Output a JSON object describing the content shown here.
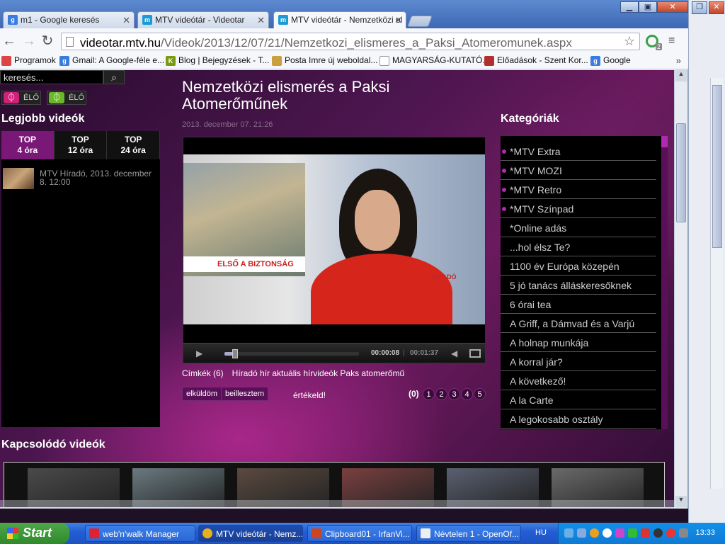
{
  "browser": {
    "tabs": [
      {
        "label": "m1 - Google keresés",
        "icon": "google-icon",
        "color": "#3a7be0"
      },
      {
        "label": "MTV videótár - Videotar",
        "icon": "mtv-icon",
        "color": "#1a9bd7"
      },
      {
        "label": "MTV videótár - Nemzetközi el",
        "icon": "mtv-icon",
        "color": "#1a9bd7"
      }
    ],
    "url_domain": "videotar.mtv.hu",
    "url_path": "/Videok/2013/12/07/21/Nemzetkozi_elismeres_a_Paksi_Atomeromunek.aspx",
    "ext_badge": "2",
    "bookmarks": [
      {
        "label": "Programok",
        "icon": "apps-icon",
        "color": "#d44"
      },
      {
        "label": "Gmail: A Google-féle e...",
        "icon": "google-icon",
        "color": "#3a7be0"
      },
      {
        "label": "Blog | Bejegyzések - T...",
        "icon": "k-icon",
        "color": "#7a9a10"
      },
      {
        "label": "Posta Imre új weboldal...",
        "icon": "posta-icon",
        "color": "#c9a040"
      },
      {
        "label": "MAGYARSÁG-KUTATÓ...",
        "icon": "page-icon",
        "color": "#bbb"
      },
      {
        "label": "Előadások - Szent Kor...",
        "icon": "crown-icon",
        "color": "#b03030"
      },
      {
        "label": "Google",
        "icon": "google-icon",
        "color": "#3a7be0"
      }
    ],
    "bookmarks_more": "»"
  },
  "sidebar": {
    "search_placeholder": "keresés...",
    "live": [
      {
        "label": "ÉLŐ",
        "color": "#d0207a"
      },
      {
        "label": "ÉLŐ",
        "color": "#6ab82a"
      }
    ],
    "best_title": "Legjobb videók",
    "top_tabs": [
      {
        "line1": "TOP",
        "line2": "4 óra"
      },
      {
        "line1": "TOP",
        "line2": "12 óra"
      },
      {
        "line1": "TOP",
        "line2": "24 óra"
      }
    ],
    "best_item": "MTV Híradó, 2013. december 8. 12:00"
  },
  "article": {
    "title": "Nemzetközi elismerés a Paksi Atomerőműnek",
    "date": "2013. december 07. 21:26",
    "video": {
      "inset_caption": "ELSŐ A BIZTONSÁG",
      "channel_tag": "HÍRADÓ",
      "time_current": "00:00:08",
      "time_sep": "|",
      "time_total": "00:01:37",
      "progress": 0.08
    },
    "tags_label": "Címkék (6)",
    "tags": "Híradó hír aktuális hírvideók Paks atomerőmű",
    "send_label": "elküldöm",
    "embed_label": "beillesztem",
    "rate_label": "értékeld!",
    "rate_count": "(0)",
    "stars": [
      "1",
      "2",
      "3",
      "4",
      "5"
    ]
  },
  "categories": {
    "title": "Kategóriák",
    "items": [
      {
        "label": "*MTV Extra",
        "dot": true
      },
      {
        "label": "*MTV MOZI",
        "dot": true
      },
      {
        "label": "*MTV Retro",
        "dot": true
      },
      {
        "label": "*MTV Színpad",
        "dot": true
      },
      {
        "label": "*Online adás",
        "dot": false
      },
      {
        "label": "...hol élsz Te?",
        "dot": false
      },
      {
        "label": "1100 év Európa közepén",
        "dot": false
      },
      {
        "label": "5 jó tanács álláskeresőknek",
        "dot": false
      },
      {
        "label": "6 órai tea",
        "dot": false
      },
      {
        "label": "A Griff, a Dámvad és a Varjú",
        "dot": false
      },
      {
        "label": "A holnap munkája",
        "dot": false
      },
      {
        "label": "A korral jár?",
        "dot": false
      },
      {
        "label": "A következő!",
        "dot": false
      },
      {
        "label": "A la Carte",
        "dot": false
      },
      {
        "label": "A legokosabb osztály",
        "dot": false
      }
    ]
  },
  "related": {
    "title": "Kapcsolódó videók",
    "thumb_colors": [
      "#4a4a4a",
      "#6a7a80",
      "#5a4a40",
      "#7a4040",
      "#5a6070",
      "#6a6a6a"
    ]
  },
  "taskbar": {
    "start_label": "Start",
    "tasks": [
      {
        "label": "web'n'walk Manager",
        "color": "#d23"
      },
      {
        "label": "MTV videótár - Nemz...",
        "color": "#e8b020"
      },
      {
        "label": "Clipboard01 - IrfanVi...",
        "color": "#c42"
      },
      {
        "label": "Névtelen 1 - OpenOf...",
        "color": "#eee"
      }
    ],
    "lang": "HU",
    "clock": "13:33"
  }
}
